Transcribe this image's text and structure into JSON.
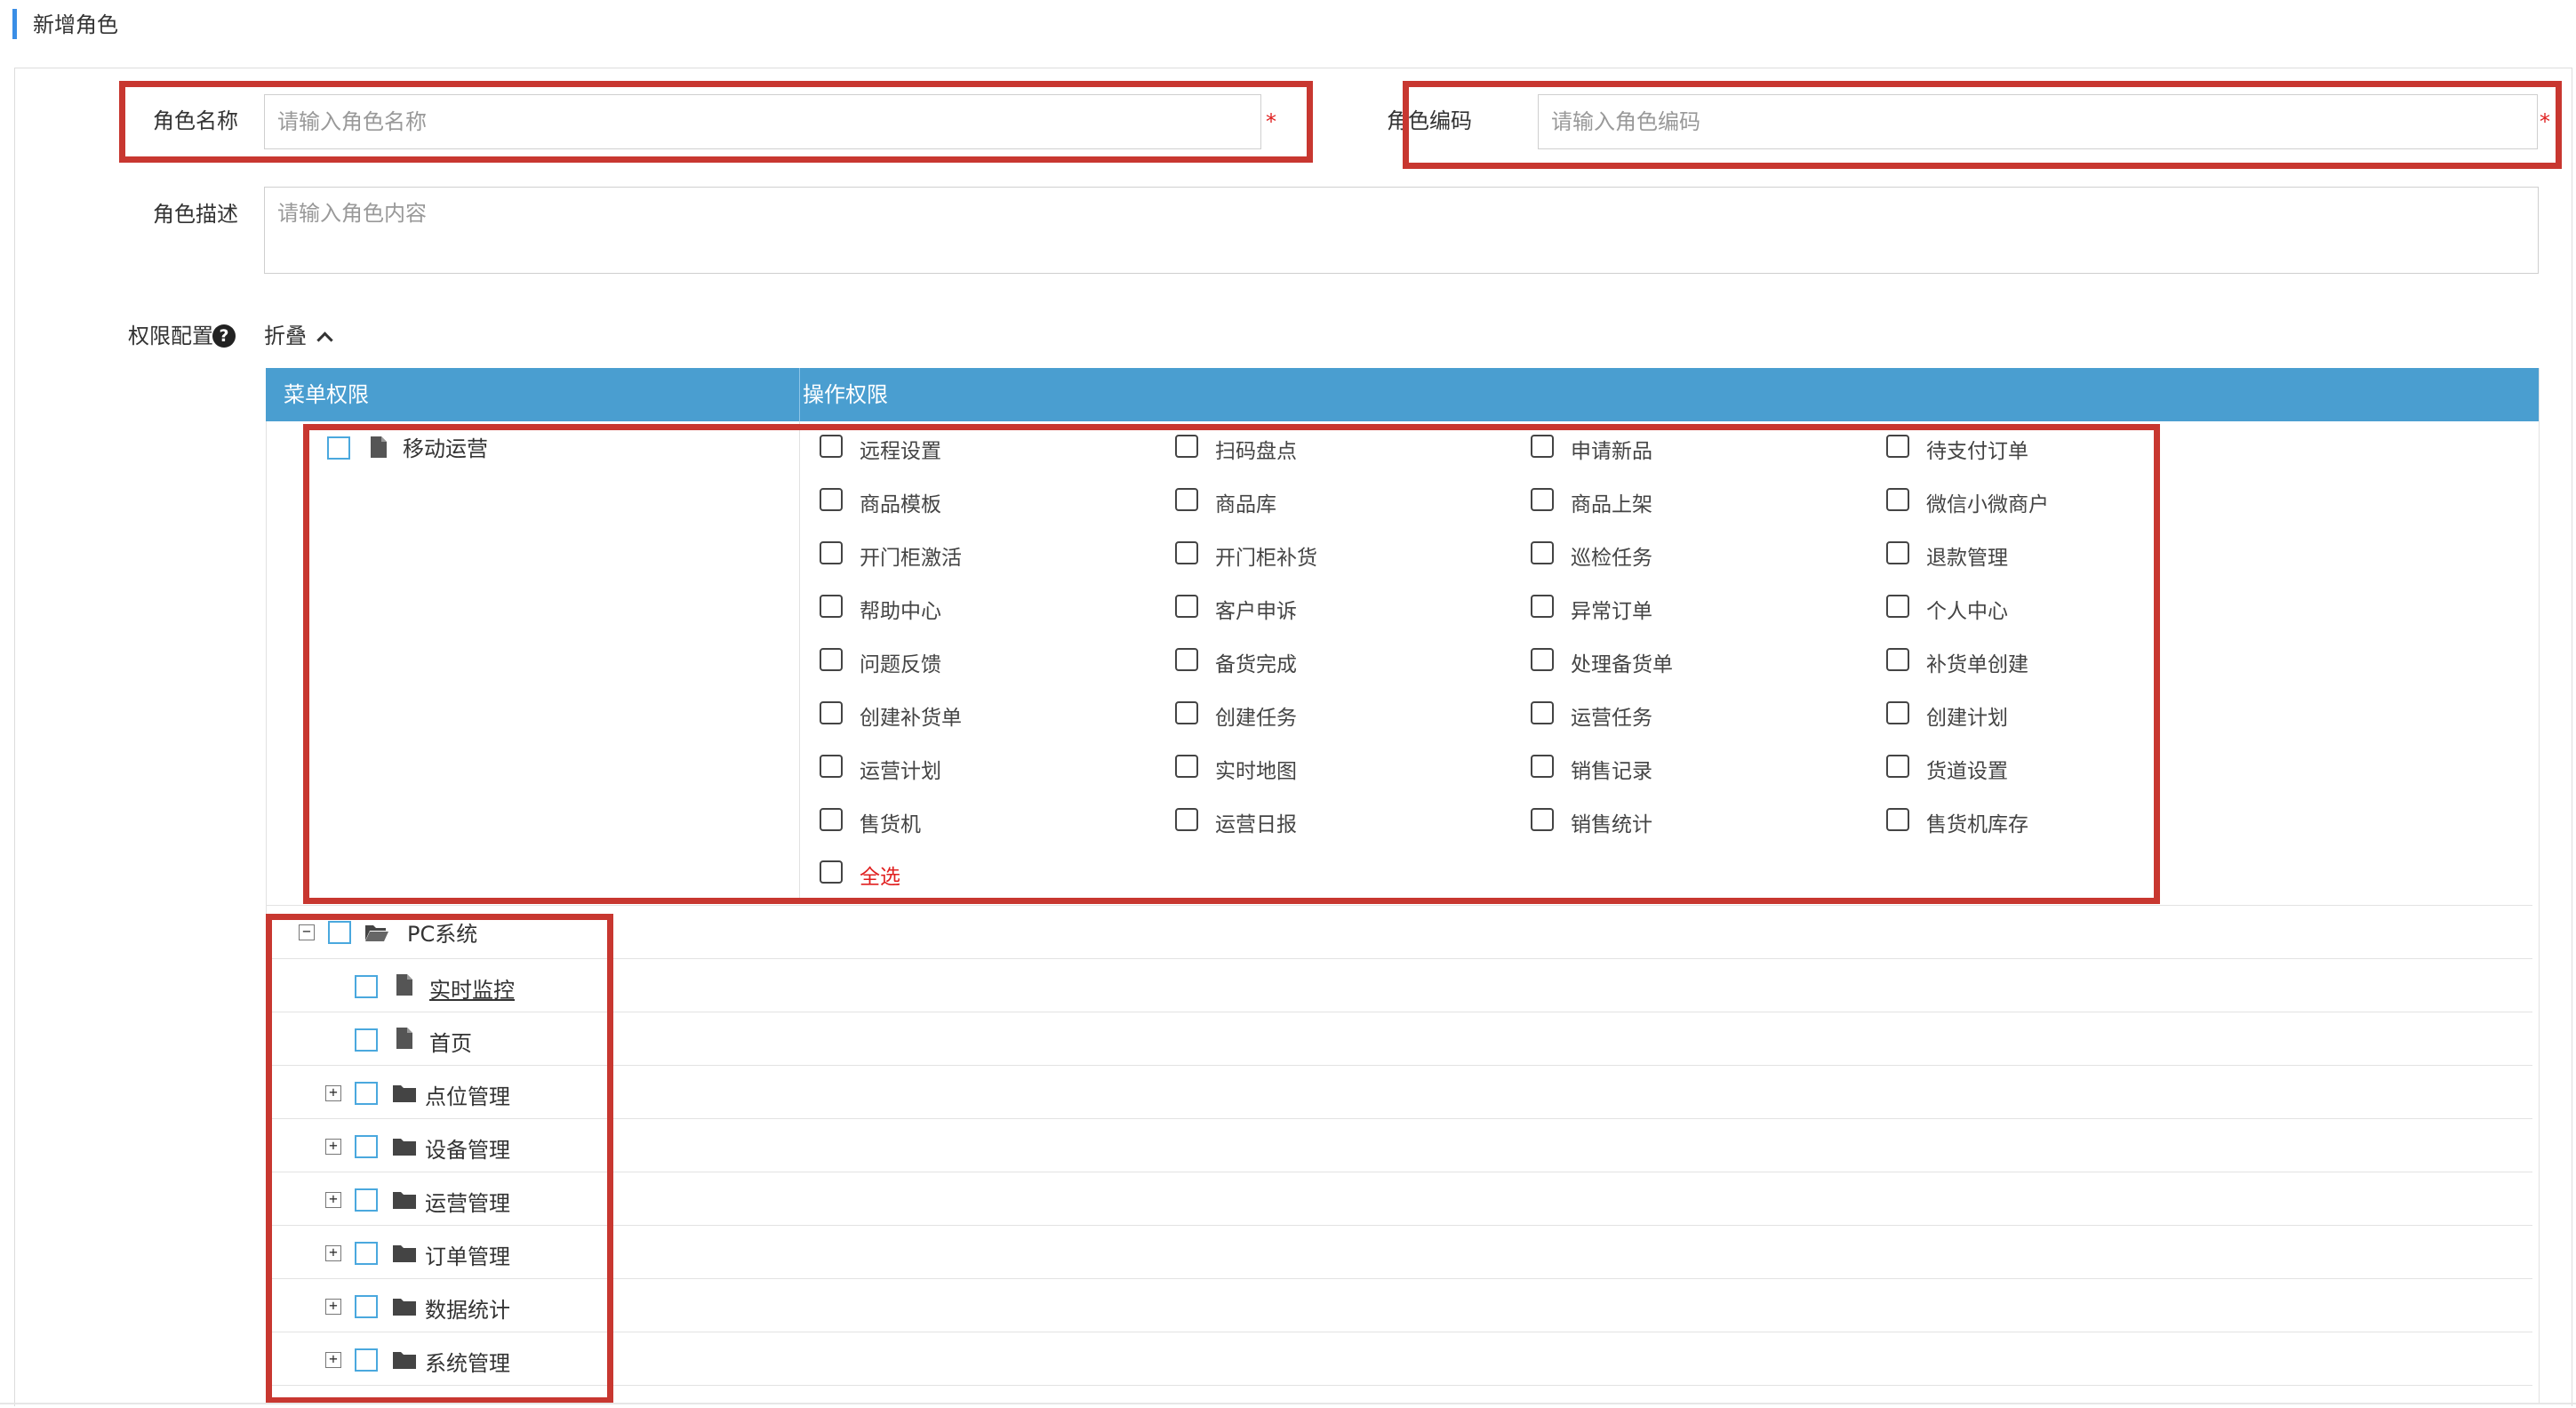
{
  "page": {
    "title": "新增角色"
  },
  "form": {
    "role_name": {
      "label": "角色名称",
      "placeholder": "请输入角色名称",
      "required_mark": "*"
    },
    "role_code": {
      "label": "角色编码",
      "placeholder": "请输入角色编码",
      "required_mark": "*"
    },
    "role_desc": {
      "label": "角色描述",
      "placeholder": "请输入角色内容"
    },
    "permission": {
      "label": "权限配置",
      "help_icon": "?",
      "fold_label": "折叠"
    }
  },
  "table": {
    "columns": [
      "菜单权限",
      "操作权限"
    ],
    "mobile": {
      "name": "移动运营",
      "options": [
        [
          "远程设置",
          "扫码盘点",
          "申请新品",
          "待支付订单"
        ],
        [
          "商品模板",
          "商品库",
          "商品上架",
          "微信小微商户"
        ],
        [
          "开门柜激活",
          "开门柜补货",
          "巡检任务",
          "退款管理"
        ],
        [
          "帮助中心",
          "客户申诉",
          "异常订单",
          "个人中心"
        ],
        [
          "问题反馈",
          "备货完成",
          "处理备货单",
          "补货单创建"
        ],
        [
          "创建补货单",
          "创建任务",
          "运营任务",
          "创建计划"
        ],
        [
          "运营计划",
          "实时地图",
          "销售记录",
          "货道设置"
        ],
        [
          "售货机",
          "运营日报",
          "销售统计",
          "售货机库存"
        ]
      ],
      "select_all": "全选"
    },
    "pc": {
      "name": "PC系统",
      "collapse_symbol": "−",
      "expand_symbol": "+",
      "pages": [
        "实时监控",
        "首页"
      ],
      "folders": [
        "点位管理",
        "设备管理",
        "运营管理",
        "订单管理",
        "数据统计",
        "系统管理"
      ]
    }
  },
  "colors": {
    "header": "#4a9ed0",
    "highlight_box": "#c83730",
    "required": "#e02020",
    "accent": "#3a8ee6"
  },
  "icons": {
    "file": "file-icon",
    "folder": "folder-icon",
    "folder_open": "folder-open-icon",
    "help": "question-icon"
  }
}
